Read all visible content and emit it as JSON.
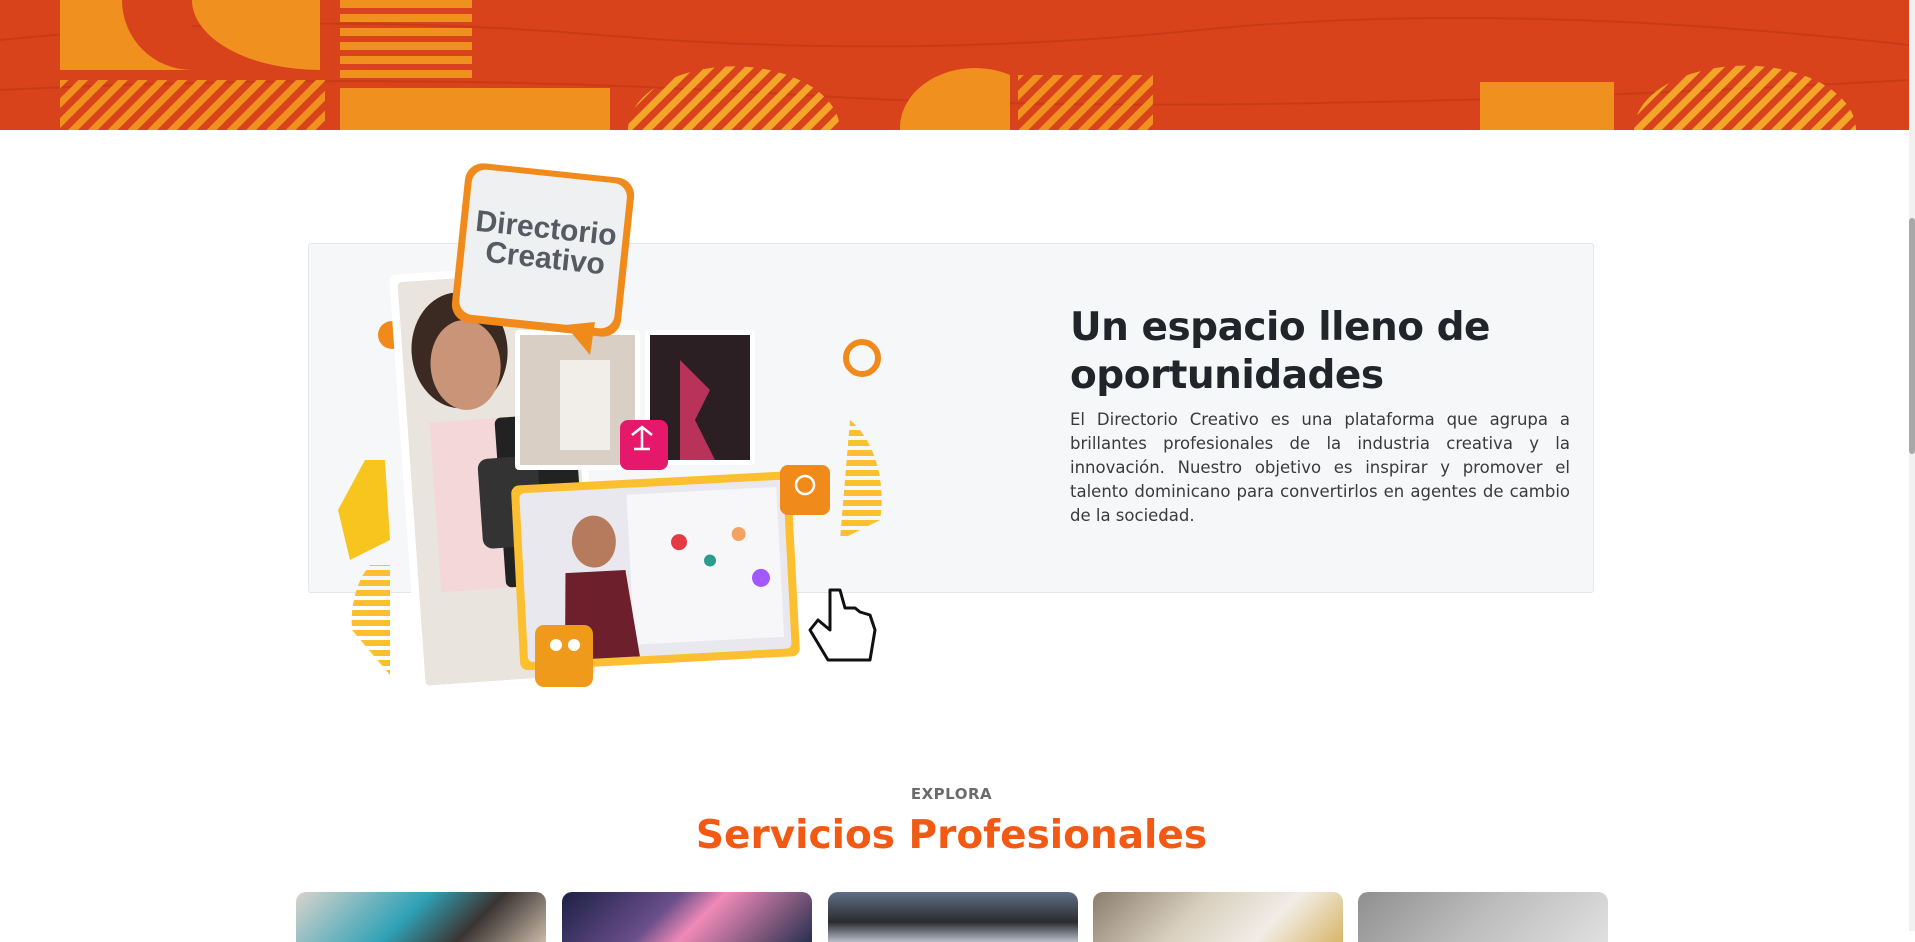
{
  "about": {
    "logo_text": [
      "Directorio",
      "Creativo"
    ],
    "heading": "Un espacio lleno de oportunidades",
    "body": "El Directorio Creativo es una plataforma que agrupa a brillantes profesionales de la industria creativa y la innovación. Nuestro objetivo es inspirar y promover el talento dominicano para convertirlos en agentes de cambio de la sociedad."
  },
  "services": {
    "eyebrow": "EXPLORA",
    "title": "Servicios Profesionales",
    "cards": [
      {
        "name": "service-card-1"
      },
      {
        "name": "service-card-2"
      },
      {
        "name": "service-card-3"
      },
      {
        "name": "service-card-4"
      },
      {
        "name": "service-card-5"
      }
    ]
  },
  "colors": {
    "banner_red": "#d9431c",
    "banner_orange": "#f0901f",
    "accent_orange": "#f25a13",
    "heading_dark": "#212529"
  }
}
